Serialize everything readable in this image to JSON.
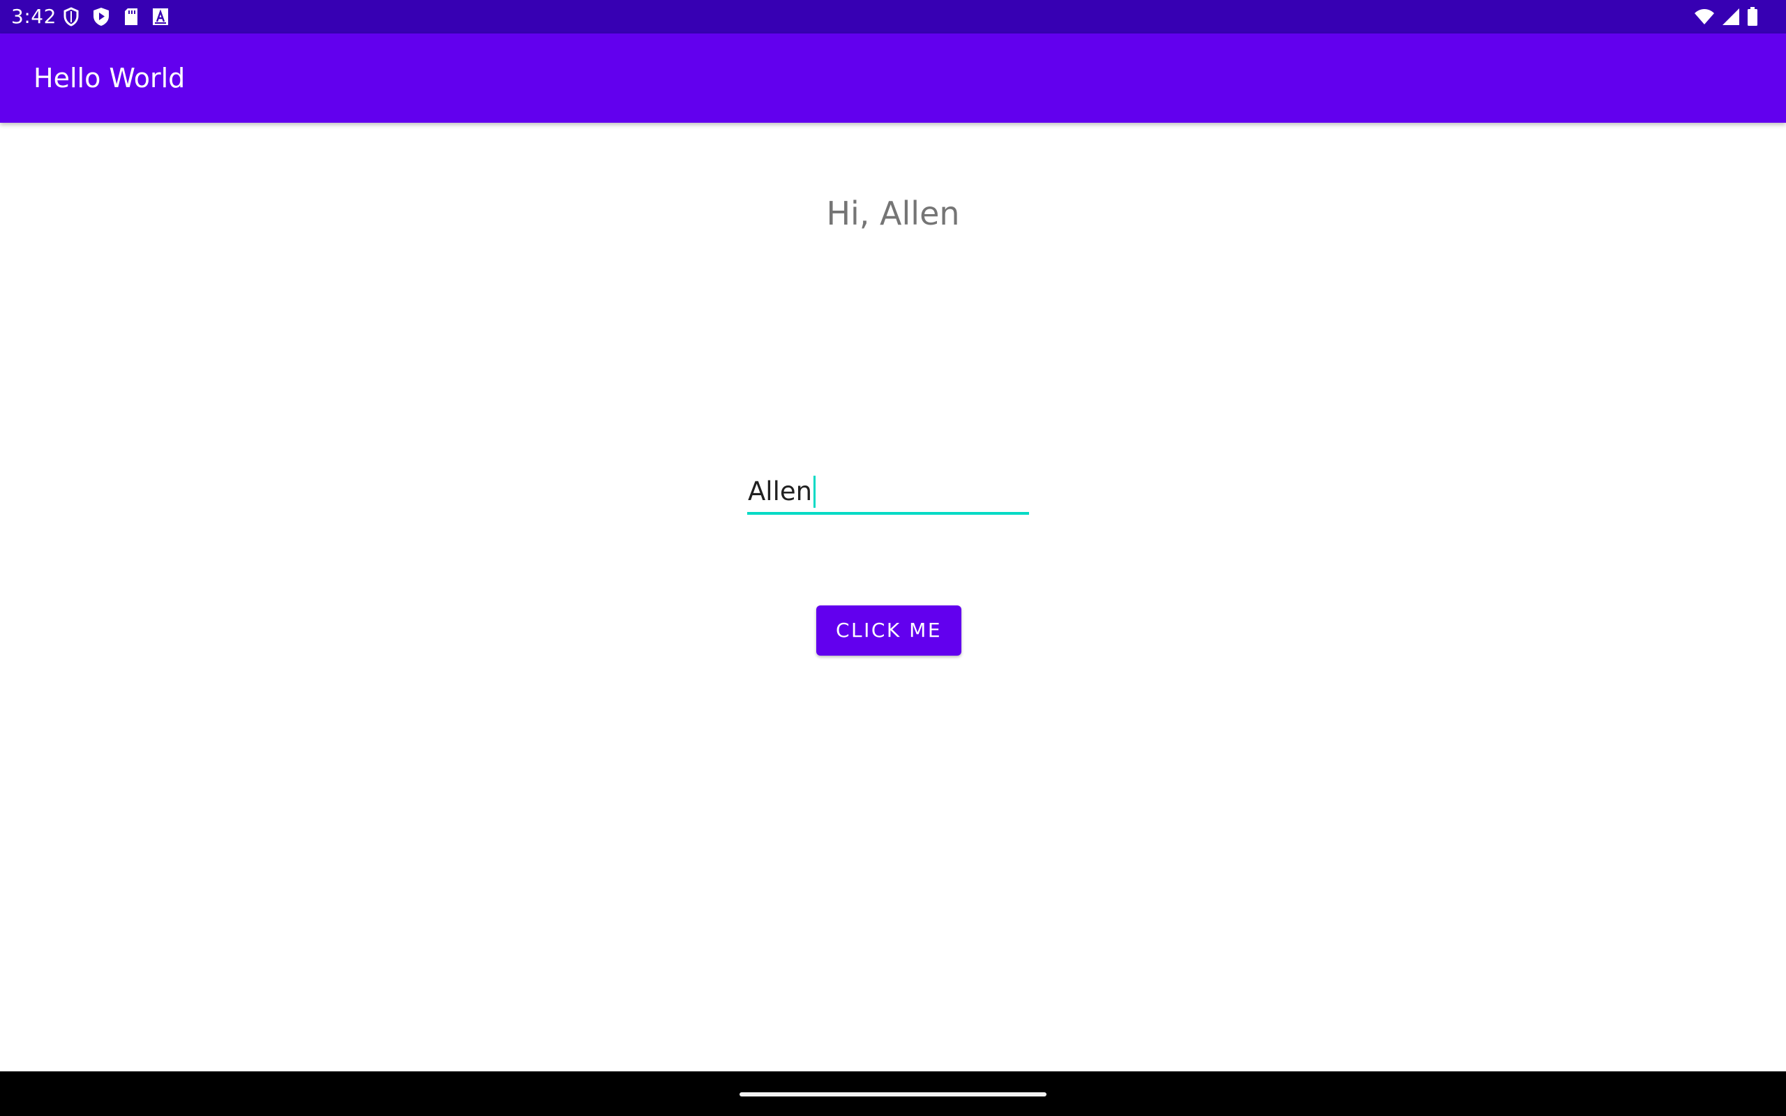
{
  "status_bar": {
    "time": "3:42",
    "left_icons": [
      "shield-icon",
      "play-protect-icon",
      "sd-card-icon",
      "font-a-icon"
    ],
    "right_icons": [
      "wifi-icon",
      "signal-icon",
      "battery-icon"
    ]
  },
  "app_bar": {
    "title": "Hello World"
  },
  "main": {
    "greeting": "Hi, Allen",
    "name_input": {
      "value": "Allen"
    },
    "button_label": "Click me"
  },
  "colors": {
    "status_bar": "#3700b3",
    "primary": "#6200ee",
    "accent": "#03dac5",
    "greeting_text": "#757575",
    "nav_bar": "#000000"
  }
}
